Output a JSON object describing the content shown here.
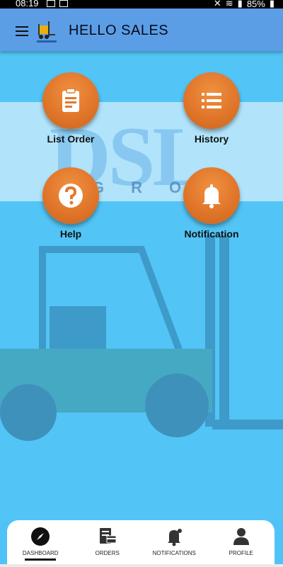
{
  "status_bar": {
    "time": "08:19",
    "battery": "85%"
  },
  "app_bar": {
    "title": "HELLO SALES"
  },
  "tiles": [
    {
      "label": "List Order"
    },
    {
      "label": "History"
    },
    {
      "label": "Help"
    },
    {
      "label": "Notification"
    }
  ],
  "background": {
    "logo_text": "DSL",
    "group_text": "GROU"
  },
  "bottom_nav": [
    {
      "label": "DASHBOARD"
    },
    {
      "label": "ORDERS"
    },
    {
      "label": "NOTIFICATIONS"
    },
    {
      "label": "PROFILE"
    }
  ],
  "colors": {
    "accent": "#e07a2c",
    "app_bar": "#5b9ee6",
    "background": "#52c4f5"
  }
}
